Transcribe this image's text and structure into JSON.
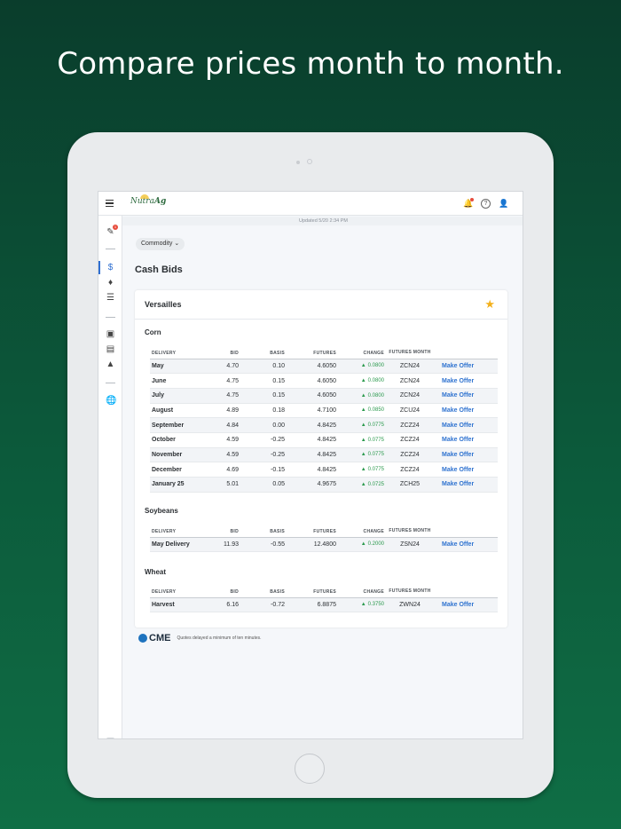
{
  "headline": "Compare prices month to month.",
  "app": {
    "logo_text": "NutraAg",
    "updated": "Updated 5/20 2:34 PM",
    "notification_count": "1"
  },
  "commodity_filter": "Commodity",
  "page_title": "Cash Bids",
  "location": "Versailles",
  "columns": {
    "delivery": "DELIVERY",
    "bid": "BID",
    "basis": "BASIS",
    "futures": "FUTURES",
    "change": "CHANGE",
    "futures_month": "FUTURES MONTH"
  },
  "offer_label": "Make Offer",
  "groups": [
    {
      "name": "Corn",
      "rows": [
        {
          "delivery": "May",
          "bid": "4.70",
          "basis": "0.10",
          "futures": "4.6050",
          "change": "0.0800",
          "month": "ZCN24"
        },
        {
          "delivery": "June",
          "bid": "4.75",
          "basis": "0.15",
          "futures": "4.6050",
          "change": "0.0800",
          "month": "ZCN24"
        },
        {
          "delivery": "July",
          "bid": "4.75",
          "basis": "0.15",
          "futures": "4.6050",
          "change": "0.0800",
          "month": "ZCN24"
        },
        {
          "delivery": "August",
          "bid": "4.89",
          "basis": "0.18",
          "futures": "4.7100",
          "change": "0.0850",
          "month": "ZCU24"
        },
        {
          "delivery": "September",
          "bid": "4.84",
          "basis": "0.00",
          "futures": "4.8425",
          "change": "0.0775",
          "month": "ZCZ24"
        },
        {
          "delivery": "October",
          "bid": "4.59",
          "basis": "-0.25",
          "futures": "4.8425",
          "change": "0.0775",
          "month": "ZCZ24"
        },
        {
          "delivery": "November",
          "bid": "4.59",
          "basis": "-0.25",
          "futures": "4.8425",
          "change": "0.0775",
          "month": "ZCZ24"
        },
        {
          "delivery": "December",
          "bid": "4.69",
          "basis": "-0.15",
          "futures": "4.8425",
          "change": "0.0775",
          "month": "ZCZ24"
        },
        {
          "delivery": "January 25",
          "bid": "5.01",
          "basis": "0.05",
          "futures": "4.9675",
          "change": "0.0725",
          "month": "ZCH25"
        }
      ]
    },
    {
      "name": "Soybeans",
      "rows": [
        {
          "delivery": "May Delivery",
          "bid": "11.93",
          "basis": "-0.55",
          "futures": "12.4800",
          "change": "0.2000",
          "month": "ZSN24"
        }
      ]
    },
    {
      "name": "Wheat",
      "rows": [
        {
          "delivery": "Harvest",
          "bid": "6.16",
          "basis": "-0.72",
          "futures": "6.8875",
          "change": "0.3750",
          "month": "ZWN24"
        }
      ]
    }
  ],
  "footer": {
    "cme_label": "CME",
    "note": "Quotes delayed a minimum of ten minutes."
  },
  "colors": {
    "background": "#0c5a3b",
    "accent_blue": "#2f73d0",
    "positive_green": "#2c9a4e",
    "star": "#f3b01b"
  }
}
